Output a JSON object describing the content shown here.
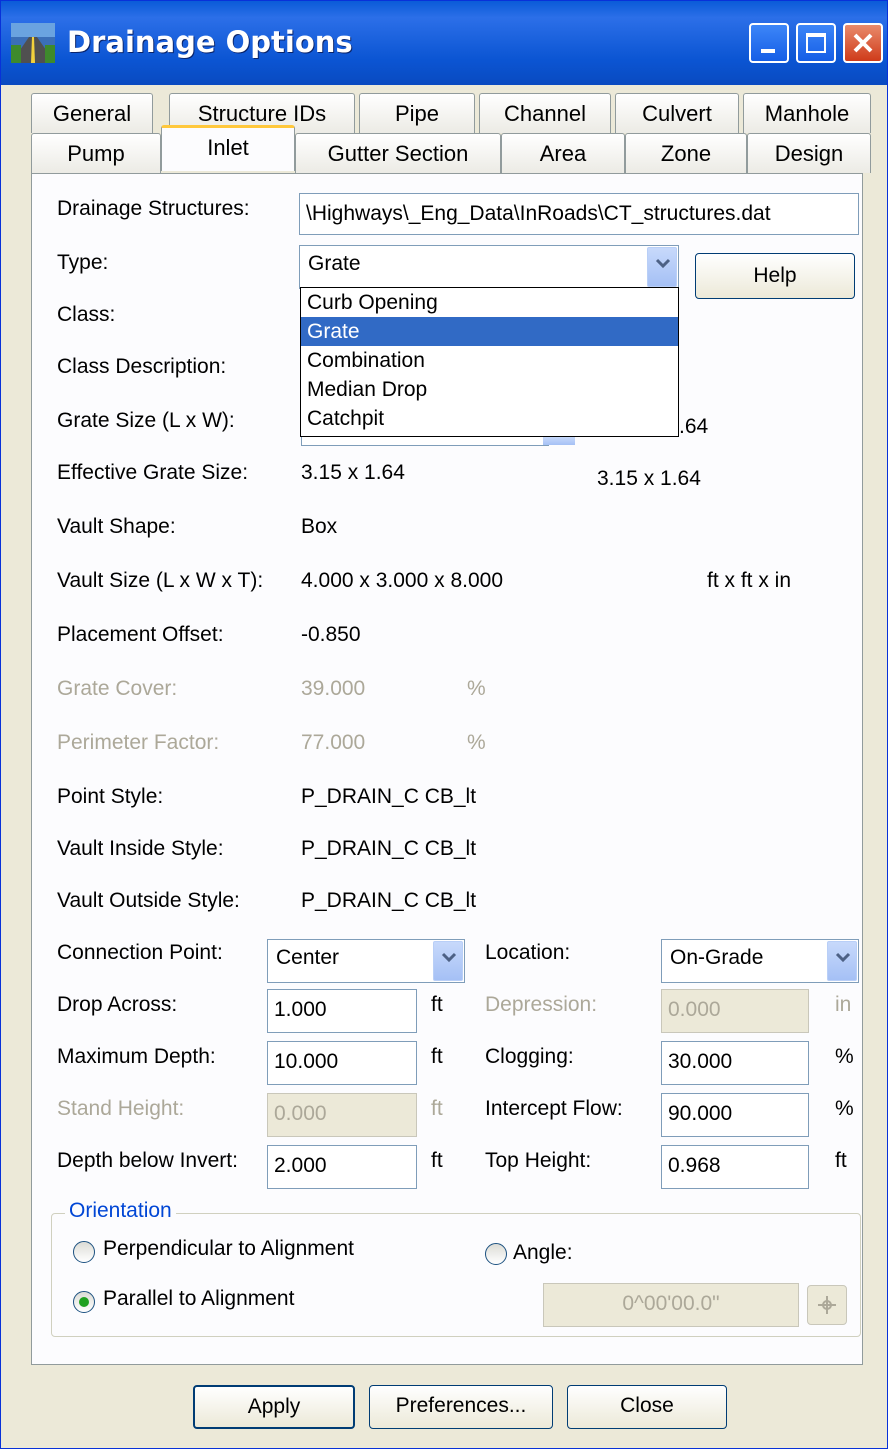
{
  "window": {
    "title": "Drainage Options"
  },
  "tabs_row1": [
    "General",
    "Structure IDs",
    "Pipe",
    "Channel",
    "Culvert",
    "Manhole"
  ],
  "tabs_row2": [
    "Pump",
    "Inlet",
    "Gutter Section",
    "Area",
    "Zone",
    "Design"
  ],
  "active_tab": "Inlet",
  "fields": {
    "drainage_structures_label": "Drainage Structures:",
    "drainage_structures_value": "\\Highways\\_Eng_Data\\InRoads\\CT_structures.dat",
    "type_label": "Type:",
    "type_value": "Grate",
    "help_button": "Help",
    "class_label": "Class:",
    "class_description_label": "Class Description:",
    "grate_size_label": "Grate Size (L x W):",
    "grate_size_right_value": ".64",
    "effective_grate_size_label": "Effective Grate Size:",
    "effective_grate_size_value": "3.15 x 1.64",
    "effective_grate_size_right": "3.15 x 1.64",
    "vault_shape_label": "Vault Shape:",
    "vault_shape_value": "Box",
    "vault_size_label": "Vault Size (L x W x T):",
    "vault_size_value": "4.000 x 3.000 x 8.000",
    "vault_size_units": "ft x ft x in",
    "placement_offset_label": "Placement Offset:",
    "placement_offset_value": "-0.850",
    "grate_cover_label": "Grate Cover:",
    "grate_cover_value": "39.000",
    "grate_cover_unit": "%",
    "perimeter_factor_label": "Perimeter Factor:",
    "perimeter_factor_value": "77.000",
    "perimeter_factor_unit": "%",
    "point_style_label": "Point Style:",
    "point_style_value": "P_DRAIN_C CB_lt",
    "vault_inside_style_label": "Vault Inside Style:",
    "vault_inside_style_value": "P_DRAIN_C CB_lt",
    "vault_outside_style_label": "Vault Outside Style:",
    "vault_outside_style_value": "P_DRAIN_C CB_lt",
    "connection_point_label": "Connection Point:",
    "connection_point_value": "Center",
    "location_label": "Location:",
    "location_value": "On-Grade",
    "drop_across_label": "Drop Across:",
    "drop_across_value": "1.000",
    "drop_across_unit": "ft",
    "depression_label": "Depression:",
    "depression_value": "0.000",
    "depression_unit": "in",
    "maximum_depth_label": "Maximum Depth:",
    "maximum_depth_value": "10.000",
    "maximum_depth_unit": "ft",
    "clogging_label": "Clogging:",
    "clogging_value": "30.000",
    "clogging_unit": "%",
    "stand_height_label": "Stand Height:",
    "stand_height_value": "0.000",
    "stand_height_unit": "ft",
    "intercept_flow_label": "Intercept Flow:",
    "intercept_flow_value": "90.000",
    "intercept_flow_unit": "%",
    "depth_below_invert_label": "Depth below Invert:",
    "depth_below_invert_value": "2.000",
    "depth_below_invert_unit": "ft",
    "top_height_label": "Top Height:",
    "top_height_value": "0.968",
    "top_height_unit": "ft"
  },
  "type_dropdown_options": [
    "Curb Opening",
    "Grate",
    "Combination",
    "Median Drop",
    "Catchpit"
  ],
  "type_dropdown_selected": "Grate",
  "orientation": {
    "title": "Orientation",
    "perpendicular_label": "Perpendicular to  Alignment",
    "parallel_label": "Parallel to Alignment",
    "angle_label": "Angle:",
    "angle_value": "0^00'00.0\"",
    "selected": "Parallel to Alignment"
  },
  "buttons": {
    "apply": "Apply",
    "preferences": "Preferences...",
    "close": "Close"
  },
  "colors": {
    "titlebar": "#0a5bd8",
    "selection": "#316ac5",
    "active_tab_accent": "#ffc83c"
  }
}
